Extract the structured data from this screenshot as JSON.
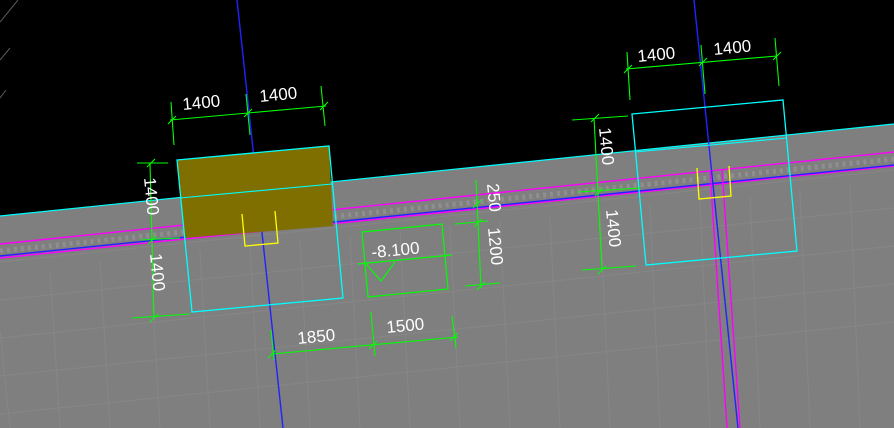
{
  "drawing": {
    "background_color": "#000000",
    "slab_color": "#7f7f7f",
    "dimension_color": "#00ff00",
    "outline_color": "#00ffff",
    "axis_color": "#0000ff",
    "beam_color": "#ff00ff",
    "marker_color": "#ffff00",
    "highlight_color": "#7f6f00"
  },
  "dimensions": {
    "left_top_a": "1400",
    "left_top_b": "1400",
    "left_side_a": "1400",
    "left_side_b": "1400",
    "right_top_a": "1400",
    "right_top_b": "1400",
    "right_side_a": "1400",
    "right_side_b": "1400",
    "mid_250": "250",
    "mid_1200": "1200",
    "bottom_1850": "1850",
    "bottom_1500": "1500"
  },
  "elevation": {
    "label": "-8.100"
  }
}
